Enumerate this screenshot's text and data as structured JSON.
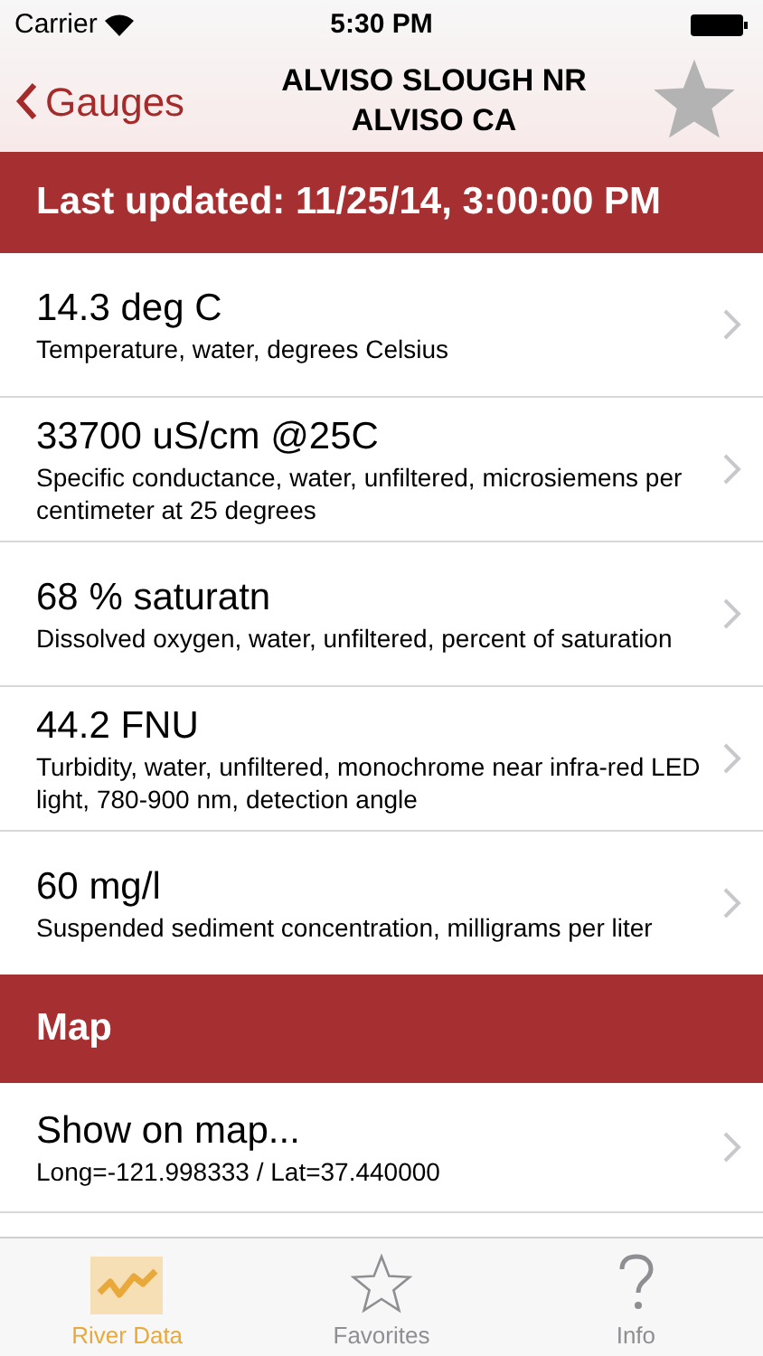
{
  "status_bar": {
    "carrier": "Carrier",
    "time": "5:30 PM"
  },
  "nav": {
    "back": "Gauges",
    "title": "ALVISO SLOUGH NR ALVISO CA"
  },
  "updated": "Last updated: 11/25/14, 3:00:00 PM",
  "readings": [
    {
      "value": "14.3 deg C",
      "description": "Temperature, water, degrees Celsius"
    },
    {
      "value": "33700 uS/cm @25C",
      "description": "Specific conductance, water, unfiltered, microsiemens per centimeter at 25 degrees"
    },
    {
      "value": "68 % saturatn",
      "description": "Dissolved oxygen, water, unfiltered, percent of saturation"
    },
    {
      "value": "44.2 FNU",
      "description": "Turbidity, water, unfiltered, monochrome near infra-red LED light, 780-900 nm, detection angle"
    },
    {
      "value": "60 mg/l",
      "description": "Suspended sediment concentration, milligrams per liter"
    }
  ],
  "map_section": {
    "header": "Map",
    "title": "Show on map...",
    "coordinates": "Long=-121.998333 / Lat=37.440000"
  },
  "tabs": [
    {
      "label": "River Data",
      "selected": true
    },
    {
      "label": "Favorites",
      "selected": false
    },
    {
      "label": "Info",
      "selected": false
    }
  ]
}
